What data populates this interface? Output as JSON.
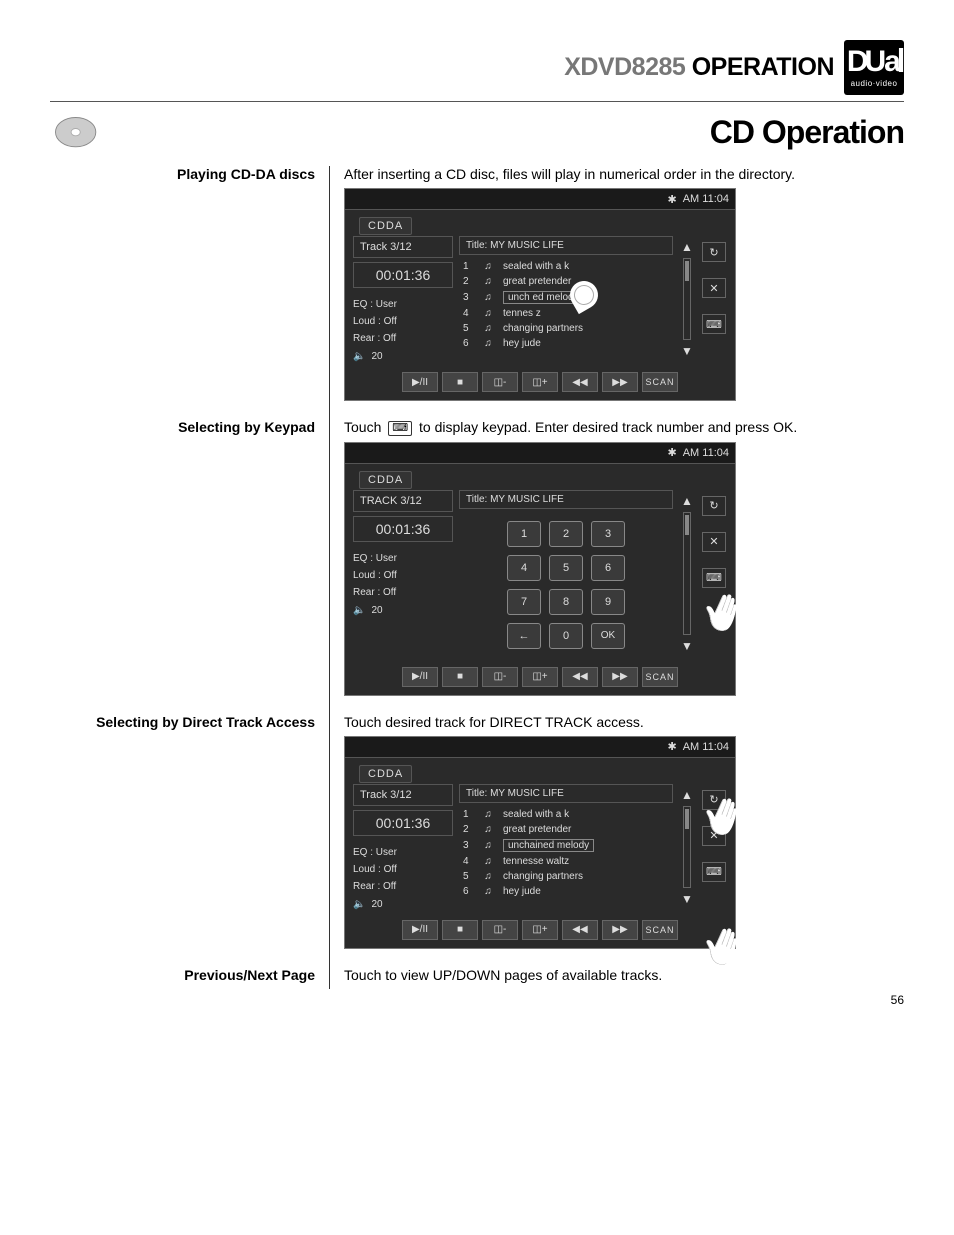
{
  "header": {
    "model": "XDVD8285",
    "label_operation": "OPERATION",
    "logo_main": "DUal",
    "logo_sub": "audio·video"
  },
  "page": {
    "section_title": "CD Operation",
    "page_number": "56"
  },
  "rows": {
    "r1_label": "Playing CD-DA discs",
    "r1_desc": "After inserting a CD disc, files will play in numerical order in the directory.",
    "r2_label": "Selecting by Keypad",
    "r2_desc_a": "Touch",
    "r2_desc_b": "to display keypad. Enter desired track number and press OK.",
    "r3_label": "Selecting by Direct Track Access",
    "r3_desc": "Touch desired track for DIRECT TRACK access.",
    "r4_label": "Previous/Next Page",
    "r4_desc": "Touch to view UP/DOWN pages of available tracks."
  },
  "screen_common": {
    "clock": "AM 11:04",
    "mode": "CDDA",
    "track_counter": "Track   3/12",
    "track_counter_caps": "TRACK  3/12",
    "elapsed": "00:01:36",
    "title_line": "Title: MY  MUSIC LIFE",
    "eq": "EQ   : User",
    "loud": "Loud : Off",
    "rear": "Rear : Off",
    "volume": "20",
    "tracks": [
      {
        "n": "1",
        "name": "sealed with a k"
      },
      {
        "n": "2",
        "name": "great pretender"
      },
      {
        "n": "3",
        "name": "unchained melody"
      },
      {
        "n": "4",
        "name": "tennesse waltz"
      },
      {
        "n": "5",
        "name": "changing partners"
      },
      {
        "n": "6",
        "name": "hey jude"
      }
    ],
    "tracks_cursor": [
      {
        "n": "1",
        "name": "sealed with a k"
      },
      {
        "n": "2",
        "name": "great pretender"
      },
      {
        "n": "3",
        "name": "unch      ed melody"
      },
      {
        "n": "4",
        "name": "tennes         z"
      },
      {
        "n": "5",
        "name": "changing partners"
      },
      {
        "n": "6",
        "name": "hey jude"
      }
    ],
    "btn_scan": "SCAN",
    "kp_ok": "OK"
  }
}
